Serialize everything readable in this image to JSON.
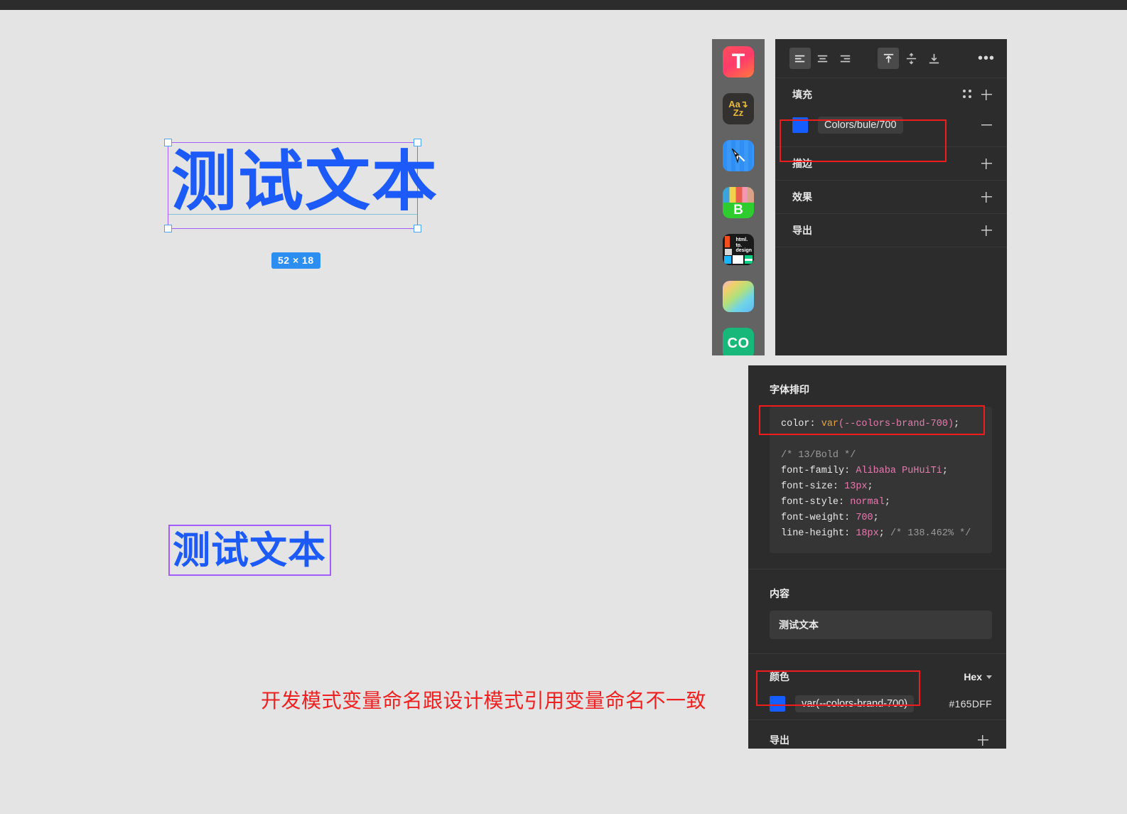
{
  "canvas": {
    "selection": {
      "text": "测试文本",
      "size_badge": "52 × 18"
    },
    "second_text": {
      "text": "测试文本"
    },
    "annotation": "开发模式变量命名跟设计模式引用变量命名不一致",
    "annotation_color": "#f02020",
    "text_color": "#1c5bfa",
    "selection_border_color": "#a25dfa"
  },
  "plugins": [
    {
      "name": "typography-plugin-icon",
      "label": "T"
    },
    {
      "name": "aa-zz-plugin-icon",
      "label_top": "Aa",
      "label_bottom": "Zz"
    },
    {
      "name": "pen-tool-plugin-icon",
      "label": ""
    },
    {
      "name": "blush-plugin-icon",
      "label": "B"
    },
    {
      "name": "html-to-design-plugin-icon",
      "line1": "html.",
      "line2": "to.",
      "line3": "design"
    },
    {
      "name": "gradient-plugin-icon",
      "label": ""
    },
    {
      "name": "co-plugin-icon",
      "label": "CO"
    }
  ],
  "design_panel": {
    "align": {
      "horizontal": [
        {
          "name": "align-left",
          "active": true
        },
        {
          "name": "align-center",
          "active": false
        },
        {
          "name": "align-right",
          "active": false
        }
      ],
      "vertical": [
        {
          "name": "align-top",
          "active": true
        },
        {
          "name": "align-middle",
          "active": false
        },
        {
          "name": "align-bottom",
          "active": false
        }
      ],
      "more_label": "•••"
    },
    "fill": {
      "title": "填充",
      "variable_name": "Colors/bule/700",
      "swatch_color": "#165DFF"
    },
    "stroke": {
      "title": "描边"
    },
    "effects": {
      "title": "效果"
    },
    "export": {
      "title": "导出"
    }
  },
  "dev_panel": {
    "typography": {
      "title": "字体排印",
      "code": {
        "color_line": {
          "prop": "color: ",
          "fn": "var",
          "value": "(--colors-brand-700)",
          "semi": ";"
        },
        "comment_style": "/* 13/Bold */",
        "lines": [
          {
            "prop": "font-family: ",
            "value": "Alibaba PuHuiTi",
            "semi": ";"
          },
          {
            "prop": "font-size: ",
            "value": "13px",
            "semi": ";"
          },
          {
            "prop": "font-style: ",
            "value": "normal",
            "semi": ";"
          },
          {
            "prop": "font-weight: ",
            "value": "700",
            "semi": ";"
          },
          {
            "prop": "line-height: ",
            "value": "18px",
            "semi": ";",
            "comment": " /* 138.462% */"
          }
        ]
      }
    },
    "content": {
      "title": "内容",
      "value": "测试文本"
    },
    "color": {
      "title": "颜色",
      "format": "Hex",
      "variable_name": "var(--colors-brand-700)",
      "hex": "#165DFF",
      "swatch_color": "#165DFF"
    },
    "export": {
      "title": "导出"
    }
  }
}
